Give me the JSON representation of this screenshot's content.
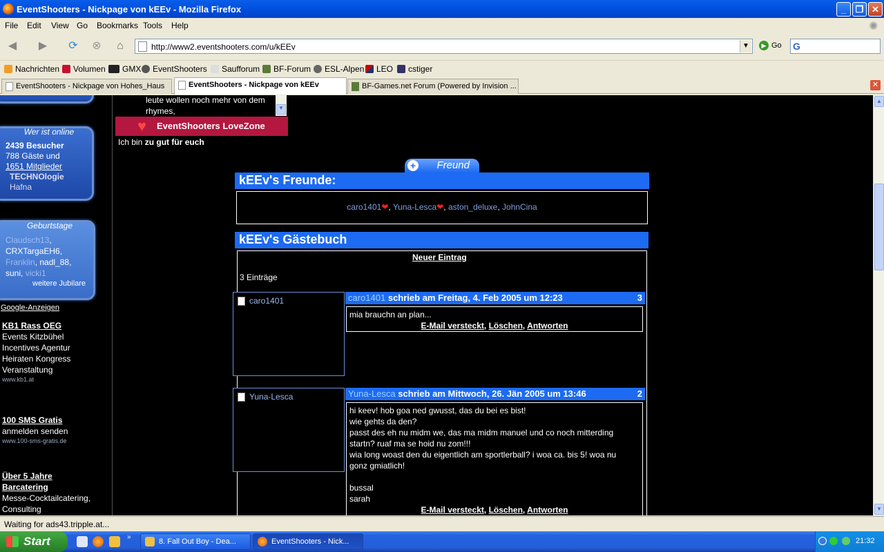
{
  "window": {
    "title": "EventShooters - Nickpage von kEEv - Mozilla Firefox"
  },
  "menu": [
    "File",
    "Edit",
    "View",
    "Go",
    "Bookmarks",
    "Tools",
    "Help"
  ],
  "nav": {
    "url": "http://www2.eventshooters.com/u/kEEv",
    "go_label": "Go",
    "search_logo": "G"
  },
  "bookmarks": [
    "Nachrichten",
    "Volumen",
    "GMX",
    "EventShooters",
    "Saufforum",
    "BF-Forum",
    "ESL-Alpen",
    "LEO",
    "cstiger"
  ],
  "tabs": [
    {
      "label": "EventShooters - Nickpage von Hohes_Haus"
    },
    {
      "label": "EventShooters - Nickpage von kEEv"
    },
    {
      "label": "BF-Games.net Forum (Powered by Invision ..."
    }
  ],
  "sidebar": {
    "online": {
      "title": "Wer ist online",
      "visitors": "2439 Besucher",
      "guests": "788 Gäste und",
      "members": "1651 Mitglieder",
      "users": [
        "TECHNOlogie",
        "Hafna"
      ]
    },
    "birthdays": {
      "title": "Geburtstage",
      "names": [
        "Claudsch13",
        "CRXTargaEH6",
        "Franklin",
        "nadl_88",
        "suni",
        "vicki1"
      ],
      "more": "weitere Jubilare"
    },
    "google": "Google-Anzeigen",
    "ads": [
      {
        "title": "KB1 Rass OEG",
        "lines": [
          "Events Kitzbühel",
          "Incentives Agentur",
          "Heiraten Kongress",
          "Veranstaltung"
        ],
        "url": "www.kb1.at"
      },
      {
        "title": "100 SMS Gratis",
        "lines": [
          "anmelden senden"
        ],
        "url": "www.100-sms-gratis.de"
      },
      {
        "title_lines": [
          "Über 5 Jahre",
          "Barcatering"
        ],
        "lines": [
          "Messe-Cocktailcatering,",
          "Consulting"
        ]
      }
    ]
  },
  "profile": {
    "scroll_text": [
      "leute wollen noch mehr von dem",
      "rhymes,"
    ],
    "lovezone": "EventShooters LoveZone",
    "status_prefix": "Ich bin",
    "status_value": "zu gut für euch",
    "friend_button": "Freund",
    "friends_title": "kEEv's Freunde:",
    "friends": [
      "caro1401",
      "Yuna-Lesca",
      "aston_deluxe",
      "JohnCina"
    ],
    "guestbook_title": "kEEv's Gästebuch",
    "new_entry": "Neuer Eintrag",
    "entries_count": "3 Einträge"
  },
  "entries": [
    {
      "nick": "caro1401",
      "header": "schrieb am Freitag, 4. Feb 2005 um 12:23",
      "num": "3",
      "lines": [
        "mia brauchn an plan..."
      ]
    },
    {
      "nick": "Yuna-Lesca",
      "header": "schrieb am Mittwoch, 26. Jän 2005 um 13:46",
      "num": "2",
      "lines": [
        "hi keev! hob goa ned gwusst, das du bei es bist!",
        "wie gehts da den?",
        "passt des eh nu midm we, das ma midm manuel und co noch mitterding",
        "startn? ruaf ma se hoid nu zom!!!",
        "wia long woast den du eigentlich am sportlerball? i woa ca. bis 5! woa nu",
        "gonz gmiatlich!",
        "",
        "bussal",
        "sarah"
      ]
    }
  ],
  "actions": {
    "email": "E-Mail versteckt",
    "delete": "Löschen",
    "reply": "Antworten"
  },
  "status": "Waiting for ads43.tripple.at...",
  "taskbar": {
    "start": "Start",
    "items": [
      "8. Fall Out Boy - Dea...",
      "EventShooters - Nick..."
    ],
    "clock": "21:32"
  },
  "colors": {
    "accent": "#1d6bf2",
    "background": "#000000",
    "lovezone": "#b4173f"
  }
}
